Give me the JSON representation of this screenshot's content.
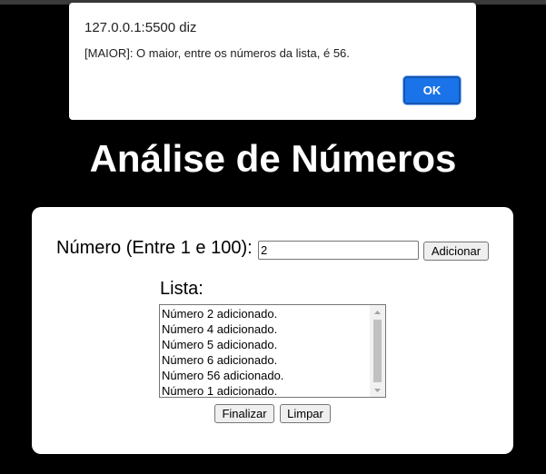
{
  "dialog": {
    "origin": "127.0.0.1:5500 diz",
    "message": "[MAIOR]: O maior, entre os números da lista, é 56.",
    "ok_label": "OK"
  },
  "page": {
    "title": "Análise de Números"
  },
  "form": {
    "number_label": "Número (Entre 1 e 100):",
    "number_value": "2",
    "add_label": "Adicionar",
    "list_label": "Lista:",
    "list_items": [
      "Número 2 adicionado.",
      "Número 4 adicionado.",
      "Número 5 adicionado.",
      "Número 6 adicionado.",
      "Número 56 adicionado.",
      "Número 1 adicionado."
    ],
    "finish_label": "Finalizar",
    "clear_label": "Limpar"
  },
  "icons": {
    "scroll_up": "scroll-up-arrow-icon",
    "scroll_down": "scroll-down-arrow-icon"
  },
  "colors": {
    "background": "#000000",
    "card": "#ffffff",
    "ok_button": "#1a73e8"
  }
}
